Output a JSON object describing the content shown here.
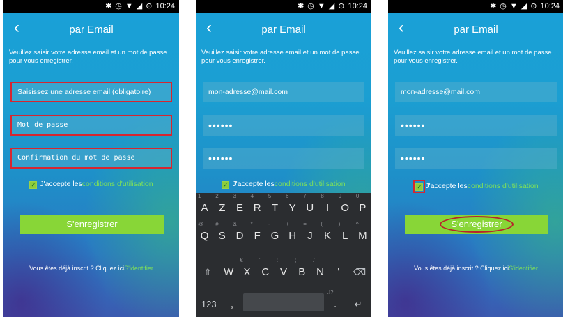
{
  "status": {
    "time": "10:24"
  },
  "app": {
    "title": "par Email",
    "intro": "Veuillez saisir votre adresse email et un mot de passe pour vous enregistrer."
  },
  "form": {
    "email_placeholder": "Saisissez une adresse email (obligatoire)",
    "password_placeholder": "Mot de passe",
    "confirm_placeholder": "Confirmation du mot de passe",
    "email_value": "mon-adresse@mail.com",
    "password_value": "••••••",
    "confirm_value": "••••••",
    "accept_text": "J'accepte les",
    "terms_link": "conditions d'utilisation",
    "register_button": "S'enregistrer"
  },
  "footer": {
    "already_text": "Vous êtes déjà inscrit ? Cliquez ici",
    "login_link": "S'identifier"
  },
  "keyboard": {
    "row1": [
      {
        "k": "A",
        "h": "1"
      },
      {
        "k": "Z",
        "h": "2"
      },
      {
        "k": "E",
        "h": "3"
      },
      {
        "k": "R",
        "h": "4"
      },
      {
        "k": "T",
        "h": "5"
      },
      {
        "k": "Y",
        "h": "6"
      },
      {
        "k": "U",
        "h": "7"
      },
      {
        "k": "I",
        "h": "8"
      },
      {
        "k": "O",
        "h": "9"
      },
      {
        "k": "P",
        "h": "0"
      }
    ],
    "row2": [
      {
        "k": "Q",
        "h": "@"
      },
      {
        "k": "S",
        "h": "#"
      },
      {
        "k": "D",
        "h": "&"
      },
      {
        "k": "F",
        "h": "*"
      },
      {
        "k": "G",
        "h": "-"
      },
      {
        "k": "H",
        "h": "+"
      },
      {
        "k": "J",
        "h": "="
      },
      {
        "k": "K",
        "h": "("
      },
      {
        "k": "L",
        "h": ")"
      },
      {
        "k": "M",
        "h": "^"
      }
    ],
    "row3": [
      {
        "k": "W",
        "h": "_"
      },
      {
        "k": "X",
        "h": "€"
      },
      {
        "k": "C",
        "h": "\""
      },
      {
        "k": "V",
        "h": ":"
      },
      {
        "k": "B",
        "h": ";"
      },
      {
        "k": "N",
        "h": "/"
      },
      {
        "k": "'",
        "h": ""
      }
    ],
    "shift": "⇧",
    "backspace": "⌫",
    "numbers": "123",
    "comma": ",",
    "period": ".",
    "period_hint": ".!?",
    "enter": "↵"
  },
  "colors": {
    "accent_green": "#88d637",
    "link_green": "#7ee05a",
    "annotation_red": "#d62630"
  }
}
